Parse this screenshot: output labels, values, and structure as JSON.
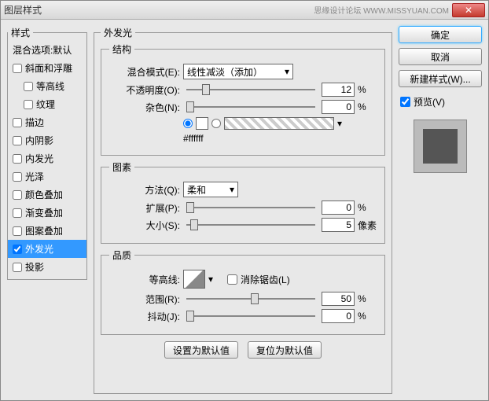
{
  "title": "图层样式",
  "watermark": "思缘设计论坛 WWW.MISSYUAN.COM",
  "sidebar": {
    "legend": "样式",
    "blending": "混合选项:默认",
    "items": [
      {
        "label": "斜面和浮雕",
        "checked": false
      },
      {
        "label": "等高线",
        "checked": false,
        "indent": true
      },
      {
        "label": "纹理",
        "checked": false,
        "indent": true
      },
      {
        "label": "描边",
        "checked": false
      },
      {
        "label": "内阴影",
        "checked": false
      },
      {
        "label": "内发光",
        "checked": false
      },
      {
        "label": "光泽",
        "checked": false
      },
      {
        "label": "颜色叠加",
        "checked": false
      },
      {
        "label": "渐变叠加",
        "checked": false
      },
      {
        "label": "图案叠加",
        "checked": false
      },
      {
        "label": "外发光",
        "checked": true,
        "selected": true
      },
      {
        "label": "投影",
        "checked": false
      }
    ]
  },
  "main": {
    "legend": "外发光",
    "structure": {
      "legend": "结构",
      "blendMode": {
        "label": "混合模式(E):",
        "value": "线性减淡（添加）"
      },
      "opacity": {
        "label": "不透明度(O):",
        "value": "12",
        "unit": "%"
      },
      "noise": {
        "label": "杂色(N):",
        "value": "0",
        "unit": "%"
      },
      "colorHex": "#ffffff"
    },
    "elements": {
      "legend": "图素",
      "technique": {
        "label": "方法(Q):",
        "value": "柔和"
      },
      "spread": {
        "label": "扩展(P):",
        "value": "0",
        "unit": "%"
      },
      "size": {
        "label": "大小(S):",
        "value": "5",
        "unit": "像素"
      }
    },
    "quality": {
      "legend": "品质",
      "contour": {
        "label": "等高线:"
      },
      "antialias": {
        "label": "消除锯齿(L)",
        "checked": false
      },
      "range": {
        "label": "范围(R):",
        "value": "50",
        "unit": "%"
      },
      "jitter": {
        "label": "抖动(J):",
        "value": "0",
        "unit": "%"
      }
    },
    "setDefault": "设置为默认值",
    "resetDefault": "复位为默认值"
  },
  "right": {
    "ok": "确定",
    "cancel": "取消",
    "newStyle": "新建样式(W)...",
    "preview": {
      "label": "预览(V)",
      "checked": true
    }
  }
}
